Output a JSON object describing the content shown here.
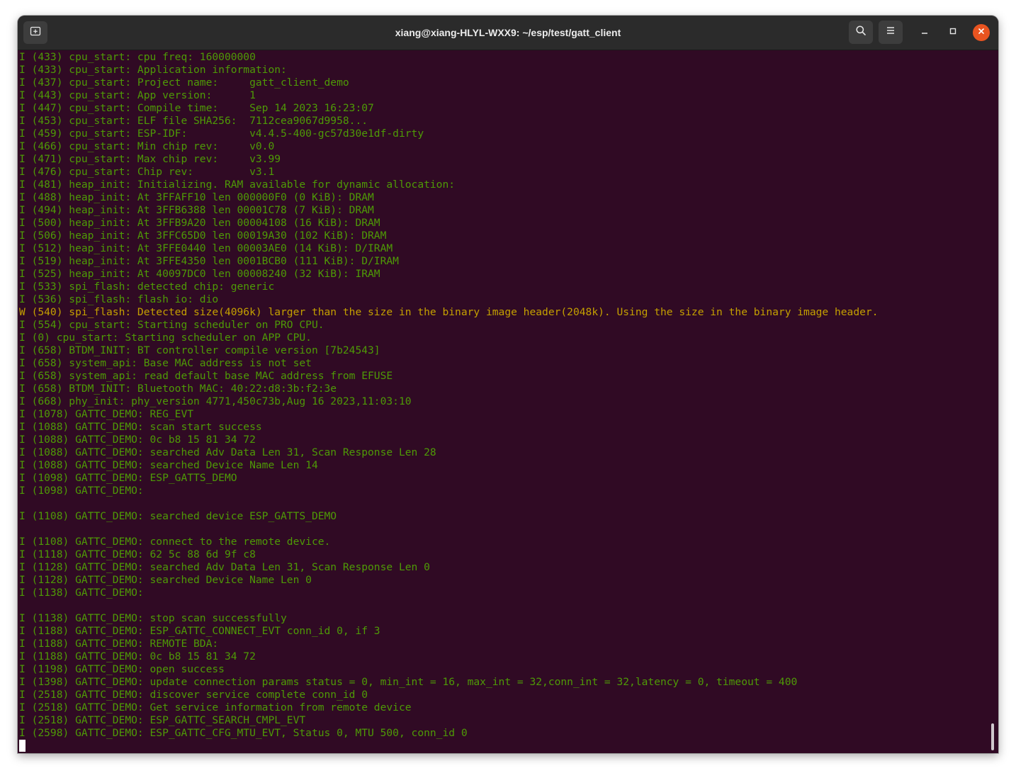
{
  "window": {
    "title": "xiang@xiang-HLYL-WXX9: ~/esp/test/gatt_client"
  },
  "header_buttons": {
    "new_tab_icon": "new-tab-icon",
    "search_icon": "search-icon",
    "menu_icon": "hamburger-menu-icon",
    "minimize_icon": "minimize-icon",
    "maximize_icon": "maximize-icon",
    "close_icon": "close-icon"
  },
  "colors": {
    "terminal_background": "#300a24",
    "info_text": "#4e9a06",
    "warning_text": "#c4a000",
    "close_button": "#e95420",
    "titlebar": "#2b2b2b"
  },
  "terminal": {
    "lines": [
      {
        "text": "I (433) cpu_start: cpu freq: 160000000",
        "level": "info"
      },
      {
        "text": "I (433) cpu_start: Application information:",
        "level": "info"
      },
      {
        "text": "I (437) cpu_start: Project name:     gatt_client_demo",
        "level": "info"
      },
      {
        "text": "I (443) cpu_start: App version:      1",
        "level": "info"
      },
      {
        "text": "I (447) cpu_start: Compile time:     Sep 14 2023 16:23:07",
        "level": "info"
      },
      {
        "text": "I (453) cpu_start: ELF file SHA256:  7112cea9067d9958...",
        "level": "info"
      },
      {
        "text": "I (459) cpu_start: ESP-IDF:          v4.4.5-400-gc57d30e1df-dirty",
        "level": "info"
      },
      {
        "text": "I (466) cpu_start: Min chip rev:     v0.0",
        "level": "info"
      },
      {
        "text": "I (471) cpu_start: Max chip rev:     v3.99",
        "level": "info"
      },
      {
        "text": "I (476) cpu_start: Chip rev:         v3.1",
        "level": "info"
      },
      {
        "text": "I (481) heap_init: Initializing. RAM available for dynamic allocation:",
        "level": "info"
      },
      {
        "text": "I (488) heap_init: At 3FFAFF10 len 000000F0 (0 KiB): DRAM",
        "level": "info"
      },
      {
        "text": "I (494) heap_init: At 3FFB6388 len 00001C78 (7 KiB): DRAM",
        "level": "info"
      },
      {
        "text": "I (500) heap_init: At 3FFB9A20 len 00004108 (16 KiB): DRAM",
        "level": "info"
      },
      {
        "text": "I (506) heap_init: At 3FFC65D0 len 00019A30 (102 KiB): DRAM",
        "level": "info"
      },
      {
        "text": "I (512) heap_init: At 3FFE0440 len 00003AE0 (14 KiB): D/IRAM",
        "level": "info"
      },
      {
        "text": "I (519) heap_init: At 3FFE4350 len 0001BCB0 (111 KiB): D/IRAM",
        "level": "info"
      },
      {
        "text": "I (525) heap_init: At 40097DC0 len 00008240 (32 KiB): IRAM",
        "level": "info"
      },
      {
        "text": "I (533) spi_flash: detected chip: generic",
        "level": "info"
      },
      {
        "text": "I (536) spi_flash: flash io: dio",
        "level": "info"
      },
      {
        "text": "W (540) spi_flash: Detected size(4096k) larger than the size in the binary image header(2048k). Using the size in the binary image header.",
        "level": "warn"
      },
      {
        "text": "I (554) cpu_start: Starting scheduler on PRO CPU.",
        "level": "info"
      },
      {
        "text": "I (0) cpu_start: Starting scheduler on APP CPU.",
        "level": "info"
      },
      {
        "text": "I (658) BTDM_INIT: BT controller compile version [7b24543]",
        "level": "info"
      },
      {
        "text": "I (658) system_api: Base MAC address is not set",
        "level": "info"
      },
      {
        "text": "I (658) system_api: read default base MAC address from EFUSE",
        "level": "info"
      },
      {
        "text": "I (658) BTDM_INIT: Bluetooth MAC: 40:22:d8:3b:f2:3e",
        "level": "info"
      },
      {
        "text": "I (668) phy_init: phy_version 4771,450c73b,Aug 16 2023,11:03:10",
        "level": "info"
      },
      {
        "text": "I (1078) GATTC_DEMO: REG_EVT",
        "level": "info"
      },
      {
        "text": "I (1088) GATTC_DEMO: scan start success",
        "level": "info"
      },
      {
        "text": "I (1088) GATTC_DEMO: 0c b8 15 81 34 72",
        "level": "info"
      },
      {
        "text": "I (1088) GATTC_DEMO: searched Adv Data Len 31, Scan Response Len 28",
        "level": "info"
      },
      {
        "text": "I (1088) GATTC_DEMO: searched Device Name Len 14",
        "level": "info"
      },
      {
        "text": "I (1098) GATTC_DEMO: ESP_GATTS_DEMO",
        "level": "info"
      },
      {
        "text": "I (1098) GATTC_DEMO: ",
        "level": "info"
      },
      {
        "text": "",
        "level": "info"
      },
      {
        "text": "I (1108) GATTC_DEMO: searched device ESP_GATTS_DEMO",
        "level": "info"
      },
      {
        "text": "",
        "level": "info"
      },
      {
        "text": "I (1108) GATTC_DEMO: connect to the remote device.",
        "level": "info"
      },
      {
        "text": "I (1118) GATTC_DEMO: 62 5c 88 6d 9f c8",
        "level": "info"
      },
      {
        "text": "I (1128) GATTC_DEMO: searched Adv Data Len 31, Scan Response Len 0",
        "level": "info"
      },
      {
        "text": "I (1128) GATTC_DEMO: searched Device Name Len 0",
        "level": "info"
      },
      {
        "text": "I (1138) GATTC_DEMO: ",
        "level": "info"
      },
      {
        "text": "",
        "level": "info"
      },
      {
        "text": "I (1138) GATTC_DEMO: stop scan successfully",
        "level": "info"
      },
      {
        "text": "I (1188) GATTC_DEMO: ESP_GATTC_CONNECT_EVT conn_id 0, if 3",
        "level": "info"
      },
      {
        "text": "I (1188) GATTC_DEMO: REMOTE BDA:",
        "level": "info"
      },
      {
        "text": "I (1188) GATTC_DEMO: 0c b8 15 81 34 72",
        "level": "info"
      },
      {
        "text": "I (1198) GATTC_DEMO: open success",
        "level": "info"
      },
      {
        "text": "I (1398) GATTC_DEMO: update connection params status = 0, min_int = 16, max_int = 32,conn_int = 32,latency = 0, timeout = 400",
        "level": "info"
      },
      {
        "text": "I (2518) GATTC_DEMO: discover service complete conn_id 0",
        "level": "info"
      },
      {
        "text": "I (2518) GATTC_DEMO: Get service information from remote device",
        "level": "info"
      },
      {
        "text": "I (2518) GATTC_DEMO: ESP_GATTC_SEARCH_CMPL_EVT",
        "level": "info"
      },
      {
        "text": "I (2598) GATTC_DEMO: ESP_GATTC_CFG_MTU_EVT, Status 0, MTU 500, conn_id 0",
        "level": "info"
      }
    ]
  }
}
